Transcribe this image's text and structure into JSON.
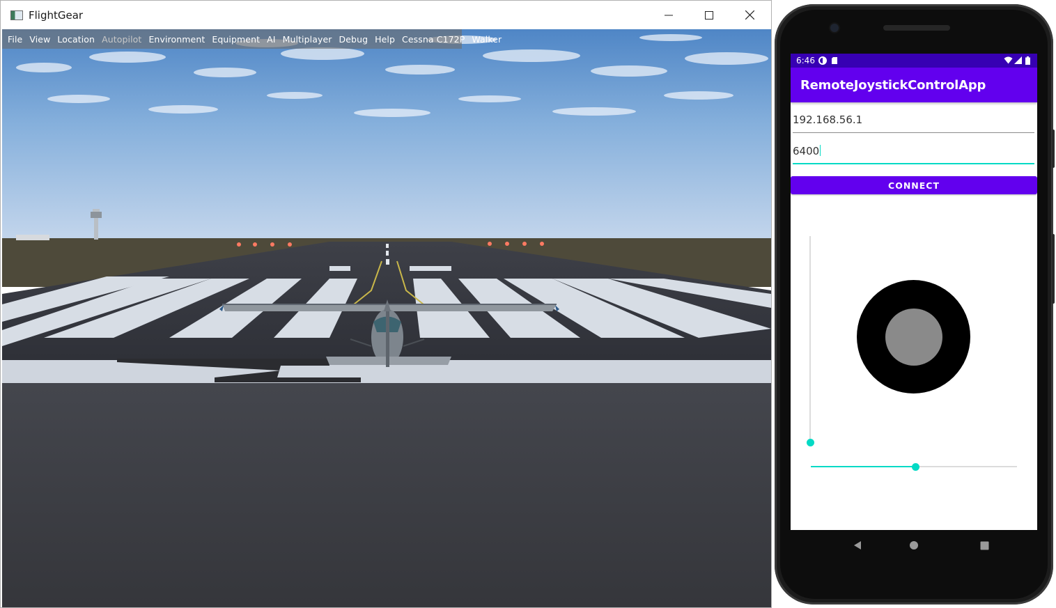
{
  "flightgear": {
    "window_title": "FlightGear",
    "menu": [
      {
        "label": "File",
        "enabled": true
      },
      {
        "label": "View",
        "enabled": true
      },
      {
        "label": "Location",
        "enabled": true
      },
      {
        "label": "Autopilot",
        "enabled": false
      },
      {
        "label": "Environment",
        "enabled": true
      },
      {
        "label": "Equipment",
        "enabled": true
      },
      {
        "label": "AI",
        "enabled": true
      },
      {
        "label": "Multiplayer",
        "enabled": true
      },
      {
        "label": "Debug",
        "enabled": true
      },
      {
        "label": "Help",
        "enabled": true
      },
      {
        "label": "Cessna C172P",
        "enabled": true
      },
      {
        "label": "Walker",
        "enabled": true
      }
    ],
    "window_controls": [
      "minimize-icon",
      "maximize-icon",
      "close-icon"
    ]
  },
  "phone": {
    "status_bar": {
      "time": "6:46",
      "icons": [
        "data-saver-icon",
        "sd-card-icon",
        "wifi-icon",
        "signal-icon",
        "battery-icon"
      ],
      "color": "#3700b3"
    },
    "app_title": "RemoteJoystickControlApp",
    "ip_field": {
      "value": "192.168.56.1"
    },
    "port_field": {
      "value": "6400"
    },
    "connect_label": "CONNECT",
    "primary_color": "#6200ee",
    "accent_color": "#03dac5",
    "vertical_slider": {
      "value_fraction": 0.0
    },
    "horizontal_slider": {
      "value_fraction": 0.51
    },
    "nav_bar": [
      "back-icon",
      "home-icon",
      "recents-icon"
    ]
  }
}
